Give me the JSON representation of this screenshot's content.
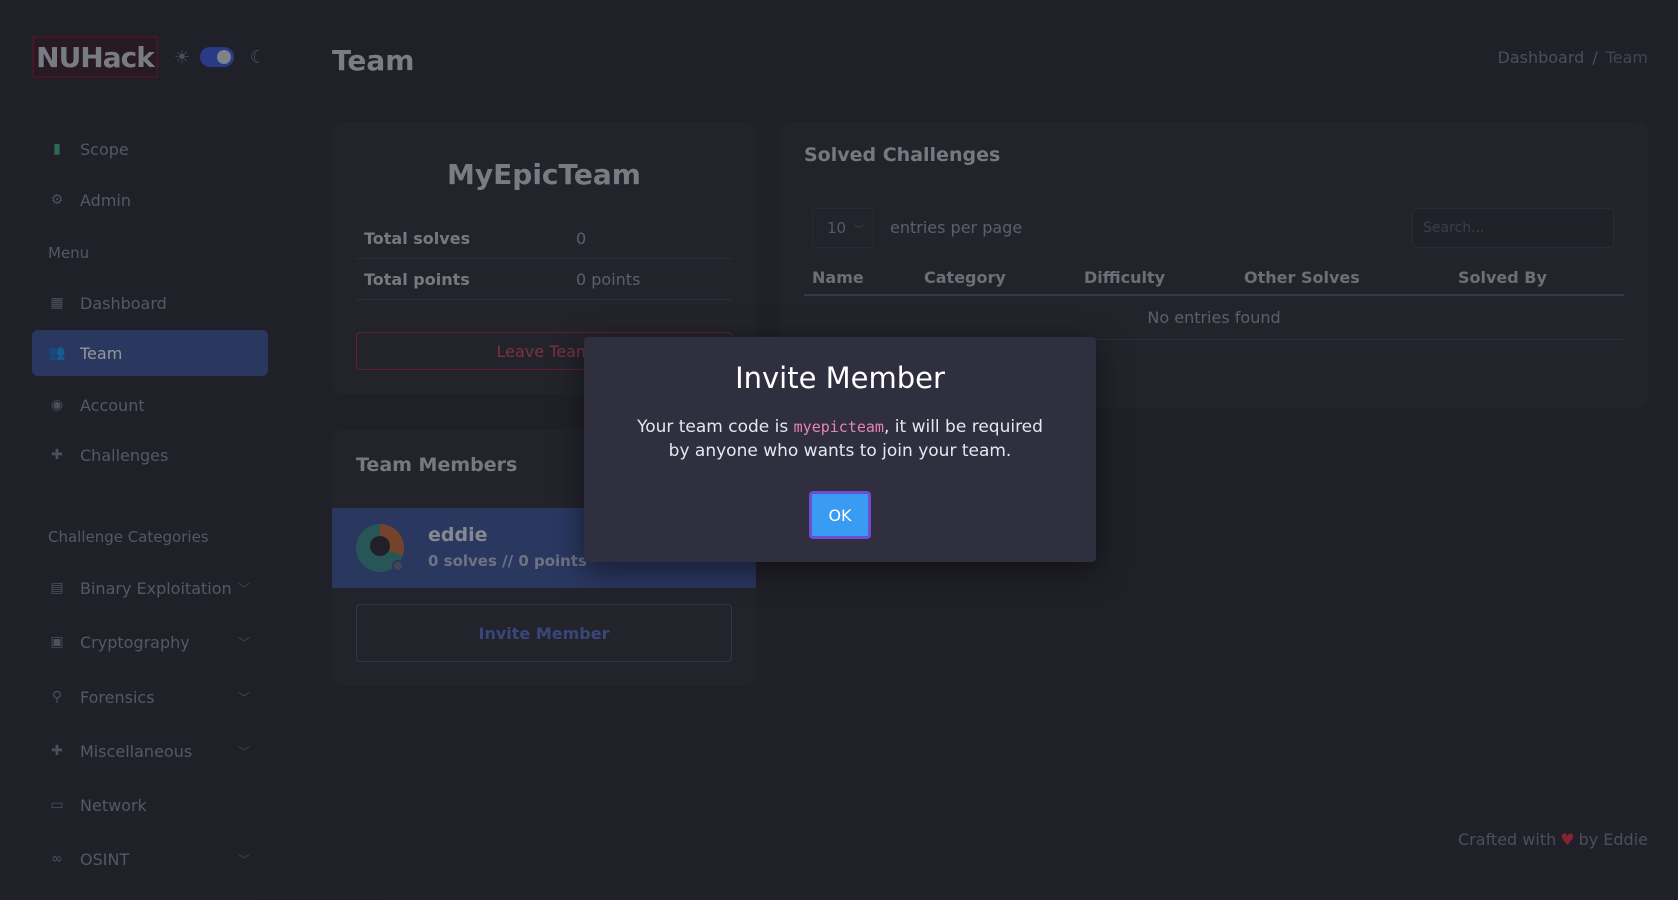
{
  "app": {
    "logo_text": "NUHack"
  },
  "sidebar": {
    "top_items": [
      {
        "label": "Scope",
        "icon": "clipboard-icon"
      },
      {
        "label": "Admin",
        "icon": "user-cog-icon"
      }
    ],
    "menu_heading": "Menu",
    "menu_items": [
      {
        "label": "Dashboard",
        "icon": "grid-icon"
      },
      {
        "label": "Team",
        "icon": "users-icon",
        "active": true
      },
      {
        "label": "Account",
        "icon": "user-circle-icon"
      },
      {
        "label": "Challenges",
        "icon": "puzzle-icon"
      }
    ],
    "categories_heading": "Challenge Categories",
    "category_items": [
      {
        "label": "Binary Exploitation",
        "icon": "binary-file-icon",
        "has_chevron": true
      },
      {
        "label": "Cryptography",
        "icon": "lock-file-icon",
        "has_chevron": true
      },
      {
        "label": "Forensics",
        "icon": "search-icon",
        "has_chevron": true
      },
      {
        "label": "Miscellaneous",
        "icon": "puzzle-icon",
        "has_chevron": true
      },
      {
        "label": "Network",
        "icon": "network-icon",
        "has_chevron": false
      },
      {
        "label": "OSINT",
        "icon": "binoculars-icon",
        "has_chevron": true
      }
    ]
  },
  "header": {
    "title": "Team",
    "breadcrumb": [
      "Dashboard",
      "/",
      "Team"
    ]
  },
  "team_card": {
    "name": "MyEpicTeam",
    "stats": [
      {
        "label": "Total solves",
        "value": "0"
      },
      {
        "label": "Total points",
        "value": "0 points"
      }
    ],
    "leave_label": "Leave Team"
  },
  "members_card": {
    "title": "Team Members",
    "members": [
      {
        "name": "eddie",
        "meta": "0 solves // 0 points"
      }
    ],
    "invite_label": "Invite Member"
  },
  "solved_card": {
    "title": "Solved Challenges",
    "per_page_value": "10",
    "per_page_label": "entries per page",
    "search_placeholder": "Search...",
    "columns": [
      "Name",
      "Category",
      "Difficulty",
      "Other Solves",
      "Solved By"
    ],
    "empty_text": "No entries found"
  },
  "footer": {
    "prefix": "Crafted with",
    "suffix": "by Eddie"
  },
  "modal": {
    "title": "Invite Member",
    "body_before": "Your team code is ",
    "team_code": "myepicteam",
    "body_after": ", it will be required by anyone who wants to join your team.",
    "ok_label": "OK"
  },
  "colors": {
    "background": "#2b2b35",
    "accent": "#3d5497",
    "danger": "#d44a5c",
    "ok_button": "#3a9bf2",
    "code": "#e783b6"
  }
}
